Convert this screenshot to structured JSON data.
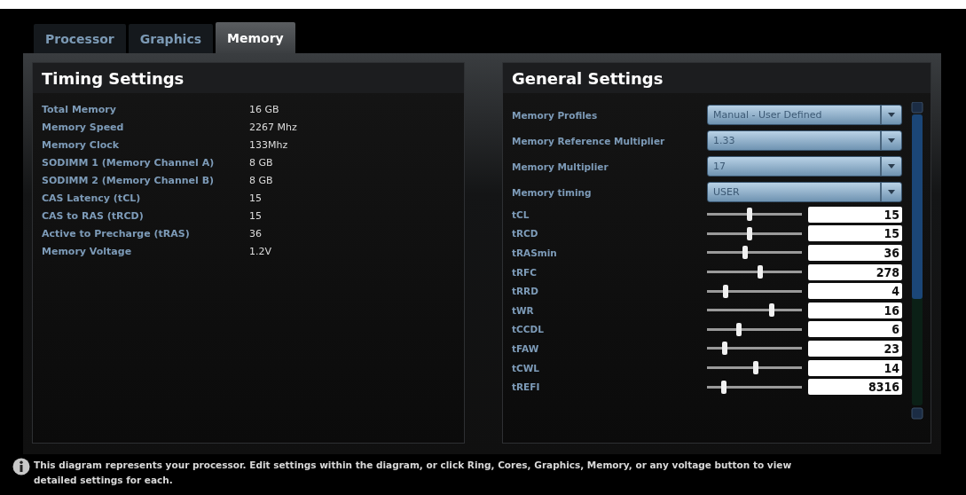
{
  "tabs": [
    {
      "label": "Processor",
      "selected": false
    },
    {
      "label": "Graphics",
      "selected": false
    },
    {
      "label": "Memory",
      "selected": true
    }
  ],
  "timing_settings": {
    "title": "Timing Settings",
    "rows": [
      {
        "label": "Total Memory",
        "value": "16 GB"
      },
      {
        "label": "Memory Speed",
        "value": "2267 Mhz"
      },
      {
        "label": "Memory Clock",
        "value": "133Mhz"
      },
      {
        "label": "SODIMM 1 (Memory Channel A)",
        "value": "8 GB"
      },
      {
        "label": "SODIMM 2 (Memory Channel B)",
        "value": "8 GB"
      },
      {
        "label": "CAS Latency (tCL)",
        "value": "15"
      },
      {
        "label": "CAS to RAS (tRCD)",
        "value": "15"
      },
      {
        "label": "Active to Precharge (tRAS)",
        "value": "36"
      },
      {
        "label": "Memory Voltage",
        "value": "1.2V"
      }
    ]
  },
  "general_settings": {
    "title": "General Settings",
    "rows": [
      {
        "kind": "dropdown",
        "label": "Memory Profiles",
        "value": "Manual - User Defined"
      },
      {
        "kind": "dropdown",
        "label": "Memory Reference Multiplier",
        "value": "1.33"
      },
      {
        "kind": "dropdown",
        "label": "Memory Multiplier",
        "value": "17"
      },
      {
        "kind": "dropdown",
        "label": "Memory timing",
        "value": "USER"
      },
      {
        "kind": "slider",
        "label": "tCL",
        "level": 0.45,
        "value": "15"
      },
      {
        "kind": "slider",
        "label": "tRCD",
        "level": 0.45,
        "value": "15"
      },
      {
        "kind": "slider",
        "label": "tRASmin",
        "level": 0.4,
        "value": "36"
      },
      {
        "kind": "slider",
        "label": "tRFC",
        "level": 0.56,
        "value": "278"
      },
      {
        "kind": "slider",
        "label": "tRRD",
        "level": 0.2,
        "value": "4"
      },
      {
        "kind": "slider",
        "label": "tWR",
        "level": 0.68,
        "value": "16"
      },
      {
        "kind": "slider",
        "label": "tCCDL",
        "level": 0.34,
        "value": "6"
      },
      {
        "kind": "slider",
        "label": "tFAW",
        "level": 0.19,
        "value": "23"
      },
      {
        "kind": "slider",
        "label": "tCWL",
        "level": 0.51,
        "value": "14"
      },
      {
        "kind": "slider",
        "label": "tREFI",
        "level": 0.18,
        "value": "8316"
      }
    ]
  },
  "info": {
    "text": "This diagram represents your processor. Edit settings within the diagram, or click Ring, Cores, Graphics, Memory, or any voltage button to view detailed settings for each."
  }
}
